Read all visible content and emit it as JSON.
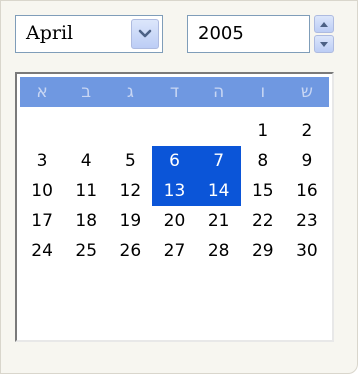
{
  "month_select": {
    "value": "April"
  },
  "year_spinner": {
    "value": "2005"
  },
  "weekday_headers": [
    "א",
    "ב",
    "ג",
    "ד",
    "ה",
    "ו",
    "ש"
  ],
  "weeks": [
    [
      "",
      "",
      "",
      "",
      "",
      "1",
      "2"
    ],
    [
      "3",
      "4",
      "5",
      "6",
      "7",
      "8",
      "9"
    ],
    [
      "10",
      "11",
      "12",
      "13",
      "14",
      "15",
      "16"
    ],
    [
      "17",
      "18",
      "19",
      "20",
      "21",
      "22",
      "23"
    ],
    [
      "24",
      "25",
      "26",
      "27",
      "28",
      "29",
      "30"
    ]
  ],
  "selected_days": [
    "6",
    "7",
    "13",
    "14"
  ],
  "colors": {
    "header_bg": "#6f98e1",
    "selection_bg": "#0b55d8",
    "selection_text": "#ffffff"
  },
  "icons": {
    "month_dropdown": "chevron-down-icon",
    "year_up": "triangle-up-icon",
    "year_down": "triangle-down-icon"
  }
}
